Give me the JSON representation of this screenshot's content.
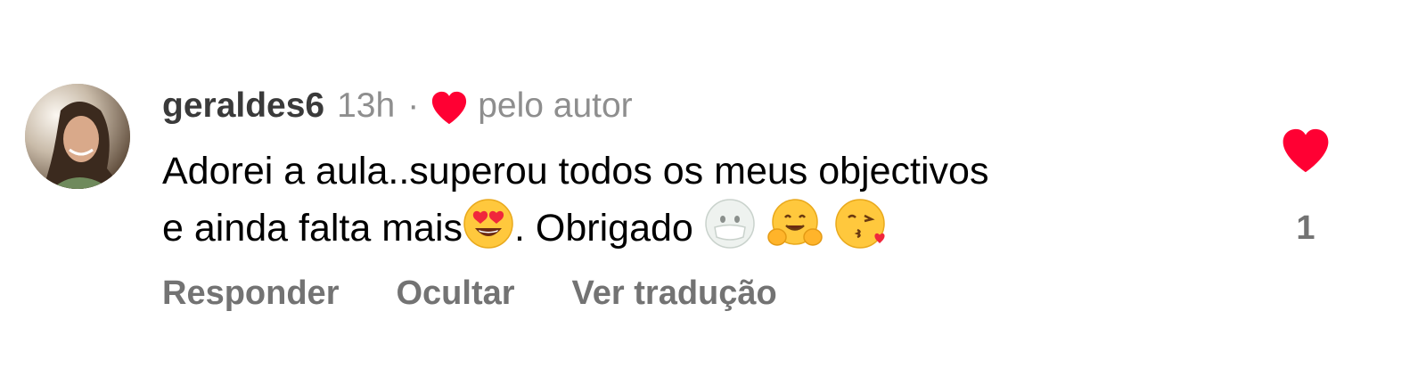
{
  "comment": {
    "username": "geraldes6",
    "time": "13h",
    "separator": "·",
    "author_label": "pelo autor",
    "text_line1": "Adorei a aula..superou todos os meus objectivos",
    "text_line2_a": "e ainda falta mais",
    "text_line2_b": ". Obrigado",
    "emojis": [
      "heart-eyes-emoji",
      "mask-face-emoji",
      "hugging-face-emoji",
      "kissing-heart-emoji"
    ],
    "like_count": "1",
    "actions": {
      "reply": "Responder",
      "hide": "Ocultar",
      "translate": "Ver tradução"
    }
  },
  "colors": {
    "heart_red": "#ff0033",
    "secondary_text": "#8e8e8e",
    "action_text": "#737373"
  },
  "icons": {
    "author_like": "heart-icon",
    "like_button": "heart-icon",
    "avatar": "avatar"
  }
}
